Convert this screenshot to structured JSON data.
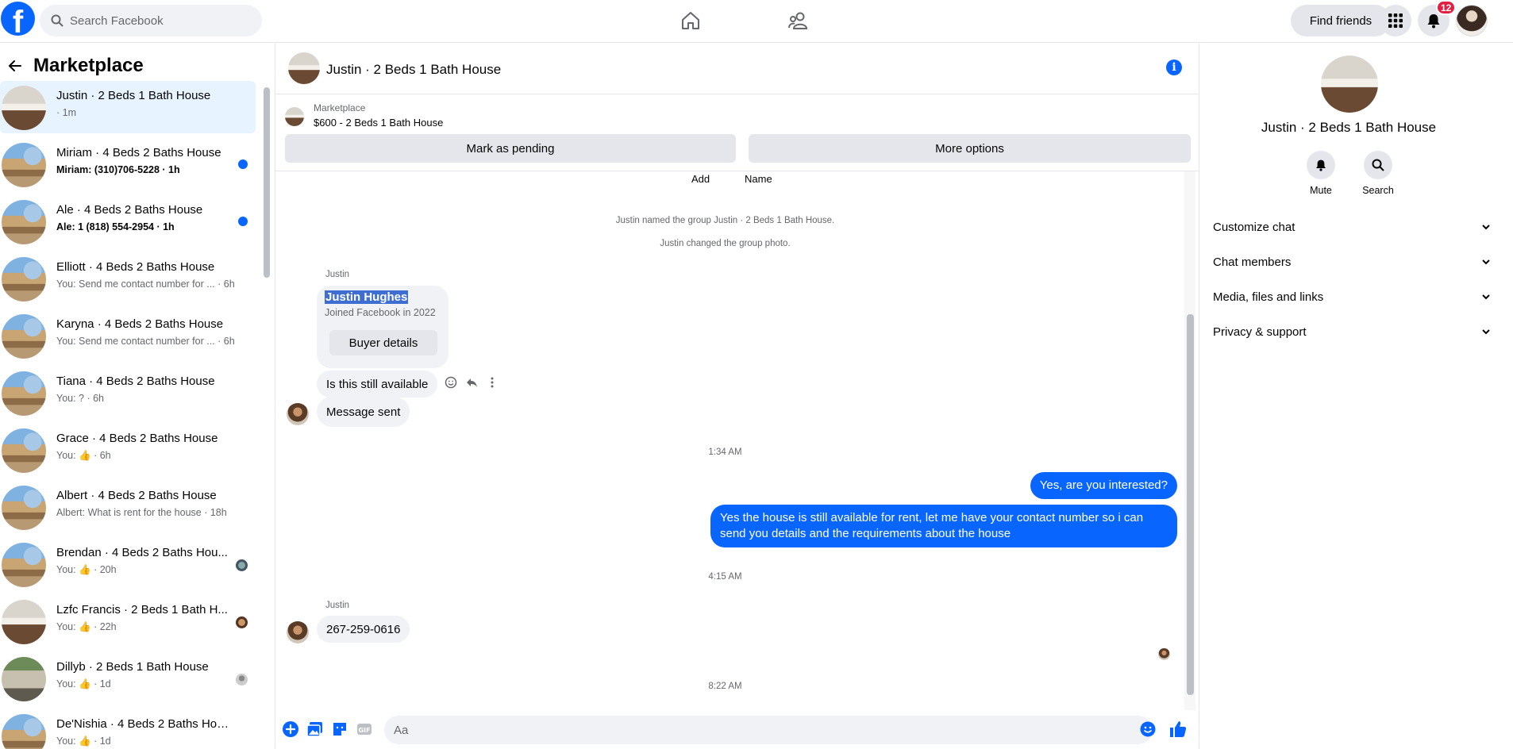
{
  "topbar": {
    "logo": "f",
    "search_placeholder": "Search Facebook",
    "find_friends": "Find friends",
    "notif_count": "12",
    "icons": [
      "home-icon",
      "friends-icon",
      "menu-grid-icon",
      "bell-icon"
    ]
  },
  "sidebar": {
    "title": "Marketplace",
    "conversations": [
      {
        "name": "Justin · 2 Beds 1 Bath House",
        "sub": " · 1m",
        "unread": false,
        "active": true
      },
      {
        "name": "Miriam · 4 Beds 2 Baths House",
        "sub": "Miriam: (310)706-5228 · 1h",
        "unread": true
      },
      {
        "name": "Ale · 4 Beds 2 Baths House",
        "sub": "Ale: 1 (818) 554-2954 · 1h",
        "unread": true
      },
      {
        "name": "Elliott · 4 Beds 2 Baths House",
        "sub": "You: Send me contact number for ... · 6h"
      },
      {
        "name": "Karyna · 4 Beds 2 Baths House",
        "sub": "You: Send me contact number for ... · 6h"
      },
      {
        "name": "Tiana · 4 Beds 2 Baths House",
        "sub": "You: ? · 6h"
      },
      {
        "name": "Grace · 4 Beds 2 Baths House",
        "sub": "You: 👍 · 6h"
      },
      {
        "name": "Albert · 4 Beds 2 Baths House",
        "sub": "Albert: What is rent for the house · 18h"
      },
      {
        "name": "Brendan · 4 Beds 2 Baths Hou...",
        "sub": "You: 👍 · 20h"
      },
      {
        "name": "Lzfc Francis · 2 Beds 1 Bath H...",
        "sub": "You: 👍 · 22h"
      },
      {
        "name": "Dillyb · 2 Beds 1 Bath House",
        "sub": "You: 👍 · 1d"
      },
      {
        "name": "De'Nishia · 4 Beds 2 Baths House",
        "sub": "You: 👍 · 1d"
      }
    ]
  },
  "chat": {
    "title": "Justin · 2 Beds 1 Bath House",
    "marketplace_label": "Marketplace",
    "listing": "$600 - 2 Beds 1 Bath House",
    "mark_pending": "Mark as pending",
    "more_options": "More options",
    "add_label": "Add",
    "name_label": "Name",
    "event1": "Justin named the group Justin · 2 Beds 1 Bath House.",
    "event2": "Justin changed the group photo.",
    "sender1": "Justin",
    "card_name": "Justin Hughes",
    "card_joined": "Joined Facebook in 2022",
    "buyer_details": "Buyer details",
    "msg_in1": "Is this still available",
    "msg_in2": "Message sent",
    "time1": "1:34 AM",
    "msg_out1": "Yes, are you interested?",
    "msg_out2": "Yes the house is still available for rent, let me have your contact number so i can send you details and the requirements about the house",
    "time2": "4:15 AM",
    "sender2": "Justin",
    "msg_in3": "267-259-0616",
    "time3": "8:22 AM",
    "composer_placeholder": "Aa"
  },
  "details": {
    "title": "Justin · 2 Beds 1 Bath House",
    "mute": "Mute",
    "search": "Search",
    "sections": [
      "Customize chat",
      "Chat members",
      "Media, files and links",
      "Privacy & support"
    ]
  },
  "colors": {
    "accent": "#0866ff",
    "badge": "#e41e3f",
    "grey": "#e4e6eb"
  }
}
